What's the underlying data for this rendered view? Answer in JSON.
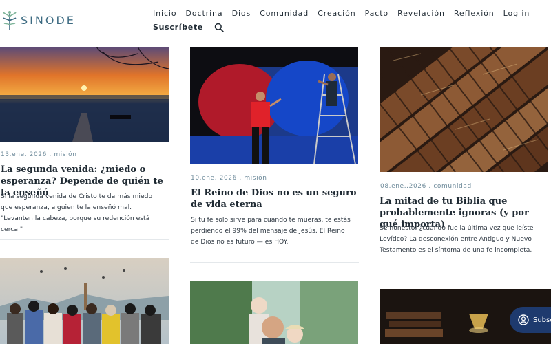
{
  "brand": {
    "name": "SINODE"
  },
  "nav": {
    "items": [
      "Inicio",
      "Doctrina",
      "Dios",
      "Comunidad",
      "Creación",
      "Pacto",
      "Revelación",
      "Reflexión",
      "Log in"
    ],
    "subscribe": "Suscríbete",
    "search_icon": "search-icon"
  },
  "posts": [
    {
      "date": "13.ene..2026",
      "category": "misión",
      "title": "La segunda venida: ¿miedo o esperanza? Depende de quién te la enseñó",
      "excerpt": "Si la segunda venida de Cristo te da más miedo que esperanza, alguien te la enseñó mal. \"Levanten la cabeza, porque su redención está cerca.\""
    },
    {
      "date": "10.ene..2026",
      "category": "misión",
      "title": "El Reino de Dios no es un seguro de vida eterna",
      "excerpt": "Si tu fe solo sirve para cuando te mueras, te estás perdiendo el 99% del mensaje de Jesús. El Reino de Dios no es futuro — es HOY."
    },
    {
      "date": "08.ene..2026",
      "category": "comunidad",
      "title": "La mitad de tu Biblia que probablemente ignoras (y por qué importa)",
      "excerpt": "Sé honesto: ¿cuándo fue la última vez que leíste Levítico? La desconexión entre Antiguo y Nuevo Testamento es el síntoma de una fe incompleta."
    }
  ],
  "separator": " . ",
  "floating_subscribe": {
    "label": "Subsc"
  },
  "colors": {
    "accent": "#3d6b82",
    "meta": "#6d8a9a",
    "button": "#1e3a6e"
  }
}
